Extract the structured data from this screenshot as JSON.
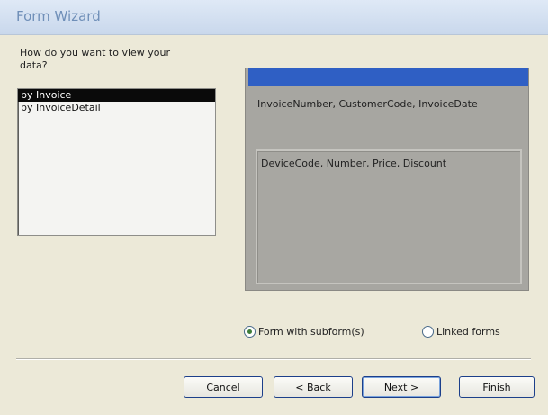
{
  "window": {
    "title": "Form Wizard"
  },
  "prompt": "How do you want to view your data?",
  "view_options": [
    "by Invoice",
    "by InvoiceDetail"
  ],
  "selected_view": "by Invoice",
  "preview": {
    "main_fields": "InvoiceNumber, CustomerCode, InvoiceDate",
    "subform_fields": "DeviceCode, Number, Price, Discount"
  },
  "layout_options": {
    "subform": "Form with subform(s)",
    "linked": "Linked forms",
    "selected": "subform"
  },
  "buttons": {
    "cancel": "Cancel",
    "back": "< Back",
    "next": "Next >",
    "finish": "Finish"
  },
  "colors": {
    "title_text": "#6f8fb8",
    "preview_bar": "#2f5fc4",
    "selection": "#0a0a0a"
  }
}
